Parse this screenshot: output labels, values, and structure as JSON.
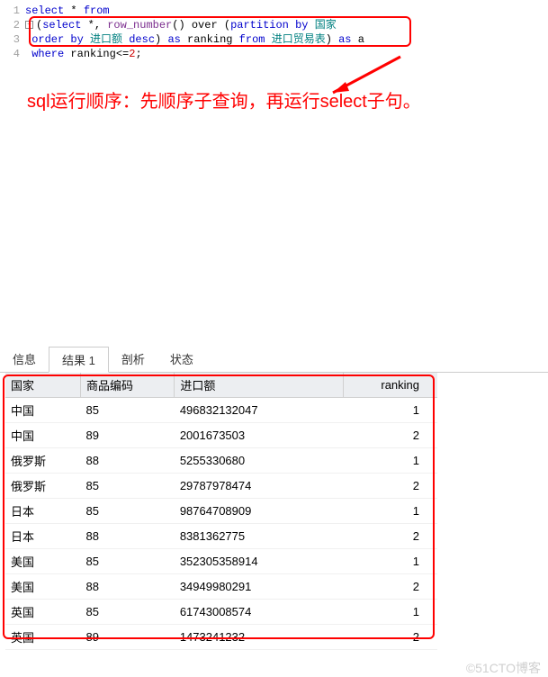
{
  "code": {
    "lines": [
      "1",
      "2",
      "3",
      "4"
    ],
    "l1_kw_select": "select",
    "l1_star": " * ",
    "l1_kw_from": "from",
    "l2_paren": "(",
    "l2_kw_select": "select",
    "l2_star": " *, ",
    "l2_fn": "row_number",
    "l2_over": "() over (",
    "l2_kw_part": "partition by",
    "l2_sp": " ",
    "l2_country": "国家",
    "l3_kw_order": "order by",
    "l3_sp1": " ",
    "l3_col": "进口额",
    "l3_sp2": " ",
    "l3_kw_desc": "desc",
    "l3_paren": ") ",
    "l3_kw_as1": "as",
    "l3_rank": " ranking ",
    "l3_kw_from": "from",
    "l3_sp3": " ",
    "l3_tbl": "进口贸易表",
    "l3_paren2": ") ",
    "l3_kw_as2": "as",
    "l3_a": " a",
    "l4_kw_where": "where",
    "l4_cond": " ranking<=",
    "l4_num": "2",
    "l4_semi": ";"
  },
  "annotation": "sql运行顺序：先顺序子查询，再运行select子句。",
  "tabs": {
    "info": "信息",
    "result": "结果 1",
    "profile": "剖析",
    "status": "状态"
  },
  "table": {
    "headers": {
      "country": "国家",
      "code": "商品编码",
      "amount": "进口额",
      "rank": "ranking"
    },
    "rows": [
      {
        "country": "中国",
        "code": "85",
        "amount": "496832132047",
        "rank": "1"
      },
      {
        "country": "中国",
        "code": "89",
        "amount": "2001673503",
        "rank": "2"
      },
      {
        "country": "俄罗斯",
        "code": "88",
        "amount": "5255330680",
        "rank": "1"
      },
      {
        "country": "俄罗斯",
        "code": "85",
        "amount": "29787978474",
        "rank": "2"
      },
      {
        "country": "日本",
        "code": "85",
        "amount": "98764708909",
        "rank": "1"
      },
      {
        "country": "日本",
        "code": "88",
        "amount": "8381362775",
        "rank": "2"
      },
      {
        "country": "美国",
        "code": "85",
        "amount": "352305358914",
        "rank": "1"
      },
      {
        "country": "美国",
        "code": "88",
        "amount": "34949980291",
        "rank": "2"
      },
      {
        "country": "英国",
        "code": "85",
        "amount": "61743008574",
        "rank": "1"
      },
      {
        "country": "英国",
        "code": "89",
        "amount": "1473241232",
        "rank": "2"
      }
    ]
  },
  "watermark": "©51CTO博客"
}
